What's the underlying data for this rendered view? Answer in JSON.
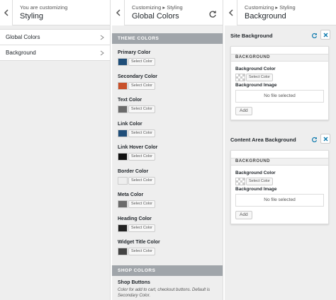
{
  "panel1": {
    "crumb": "You are customizing",
    "title": "Styling",
    "items": [
      {
        "label": "Global Colors"
      },
      {
        "label": "Background"
      }
    ]
  },
  "panel2": {
    "crumb": "Customizing ▸ Styling",
    "title": "Global Colors",
    "theme_section": "THEME COLORS",
    "select_label": "Select Color",
    "colors": [
      {
        "label": "Primary Color",
        "swatch": "#1f4e79"
      },
      {
        "label": "Secondary Color",
        "swatch": "#c8502a"
      },
      {
        "label": "Text Color",
        "swatch": "#6b6b6b"
      },
      {
        "label": "Link Color",
        "swatch": "#1f4e79"
      },
      {
        "label": "Link Hover Color",
        "swatch": "#111111"
      },
      {
        "label": "Border Color",
        "swatch": "#eeeeee"
      },
      {
        "label": "Meta Color",
        "swatch": "#6b6b6b"
      },
      {
        "label": "Heading Color",
        "swatch": "#222222"
      },
      {
        "label": "Widget Title Color",
        "swatch": "#444444"
      }
    ],
    "shop_section": "SHOP COLORS",
    "shop_label": "Shop Buttons",
    "shop_desc": "Color for add to cart, checkout buttons. Default is Secondary Color."
  },
  "panel3": {
    "crumb": "Customizing ▸ Styling",
    "title": "Background",
    "controls": [
      {
        "title": "Site Background",
        "card_head": "BACKGROUND",
        "bg_color_label": "Background Color",
        "select_label": "Select Color",
        "bg_image_label": "Background Image",
        "no_file": "No file selected",
        "add_label": "Add"
      },
      {
        "title": "Content Area Background",
        "card_head": "BACKGROUND",
        "bg_color_label": "Background Color",
        "select_label": "Select Color",
        "bg_image_label": "Background Image",
        "no_file": "No file selected",
        "add_label": "Add"
      }
    ]
  },
  "accent": "#0073aa"
}
